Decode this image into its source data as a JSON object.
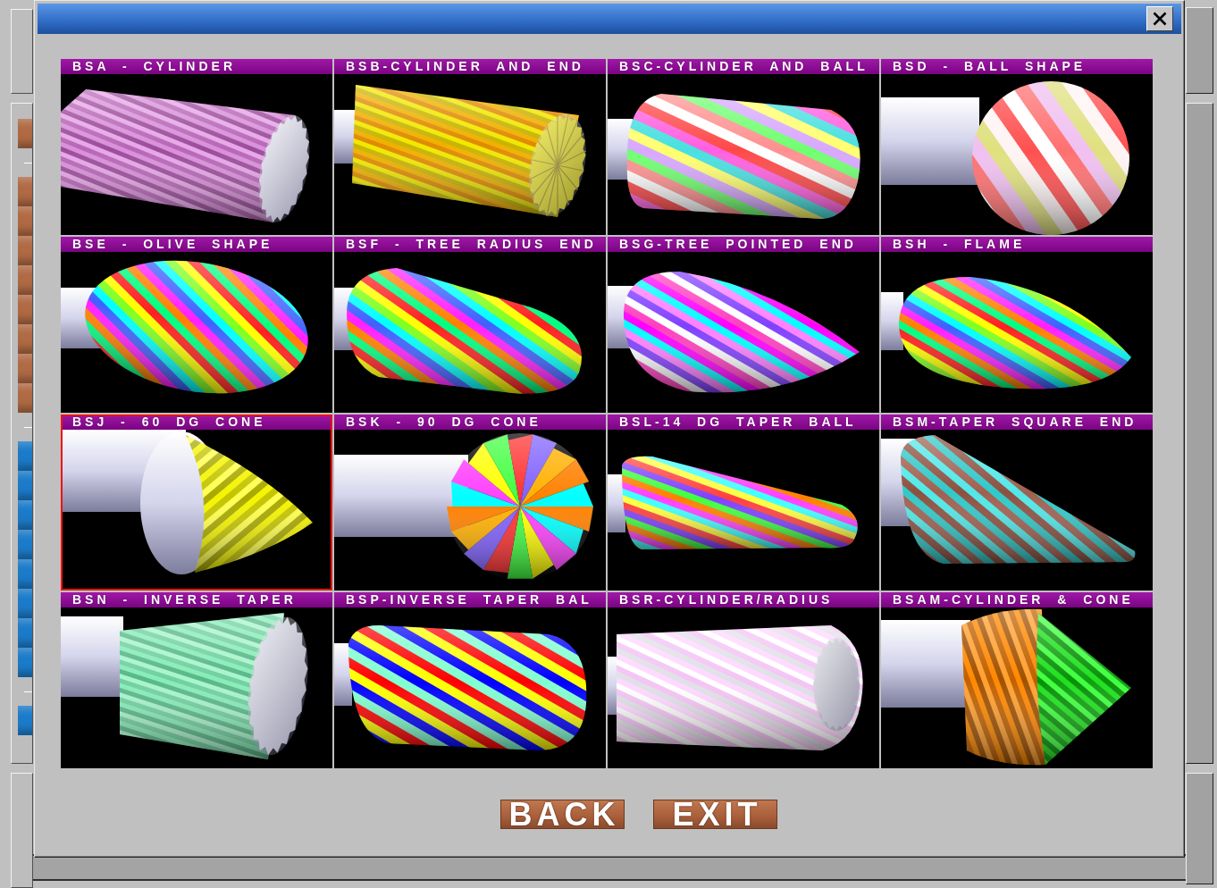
{
  "background_window": {
    "side_button_groups": [
      {
        "buttons": [
          {
            "color": "#b06a44"
          }
        ]
      },
      {
        "buttons": [
          {
            "color": "#b06a44"
          },
          {
            "color": "#b06a44"
          },
          {
            "color": "#b06a44"
          },
          {
            "color": "#b06a44"
          },
          {
            "color": "#b06a44"
          },
          {
            "color": "#b06a44"
          },
          {
            "color": "#b06a44"
          },
          {
            "color": "#b06a44"
          }
        ]
      },
      {
        "buttons": [
          {
            "color": "#1b7bc9"
          },
          {
            "color": "#1b7bc9"
          },
          {
            "color": "#1b7bc9"
          },
          {
            "color": "#1b7bc9"
          },
          {
            "color": "#1b7bc9"
          },
          {
            "color": "#1b7bc9"
          },
          {
            "color": "#1b7bc9"
          },
          {
            "color": "#1b7bc9"
          }
        ]
      },
      {
        "buttons": [
          {
            "color": "#1b7bc9"
          }
        ]
      }
    ]
  },
  "dialog": {
    "tiles": [
      {
        "label": "BSA - CYLINDER",
        "kind": "cylinder",
        "selected": false
      },
      {
        "label": "BSB-CYLINDER AND END",
        "kind": "cylinder-end",
        "selected": false
      },
      {
        "label": "BSC-CYLINDER AND BALL",
        "kind": "cylinder-ball",
        "selected": false
      },
      {
        "label": "BSD - BALL SHAPE",
        "kind": "ball",
        "selected": false
      },
      {
        "label": "BSE - OLIVE SHAPE",
        "kind": "olive",
        "selected": false
      },
      {
        "label": "BSF - TREE RADIUS END",
        "kind": "tree",
        "selected": false
      },
      {
        "label": "BSG-TREE POINTED END",
        "kind": "tree-pointed",
        "selected": false
      },
      {
        "label": "BSH - FLAME",
        "kind": "flame",
        "selected": false
      },
      {
        "label": "BSJ - 60 DG CONE",
        "kind": "cone",
        "selected": true
      },
      {
        "label": "BSK - 90 DG CONE",
        "kind": "cone-wide",
        "selected": false
      },
      {
        "label": "BSL-14 DG TAPER BALL",
        "kind": "taper-ball",
        "selected": false
      },
      {
        "label": "BSM-TAPER SQUARE END",
        "kind": "taper",
        "selected": false
      },
      {
        "label": "BSN - INVERSE TAPER",
        "kind": "inverse-taper",
        "selected": false
      },
      {
        "label": "BSP-INVERSE TAPER BAL",
        "kind": "inverse-taper-ball",
        "selected": false
      },
      {
        "label": "BSR-CYLINDER/RADIUS",
        "kind": "cylinder-radius",
        "selected": false
      },
      {
        "label": "BSAM-CYLINDER & CONE",
        "kind": "cylinder-cone",
        "selected": false
      }
    ],
    "buttons": [
      {
        "label": "BACK"
      },
      {
        "label": "EXIT"
      }
    ]
  }
}
